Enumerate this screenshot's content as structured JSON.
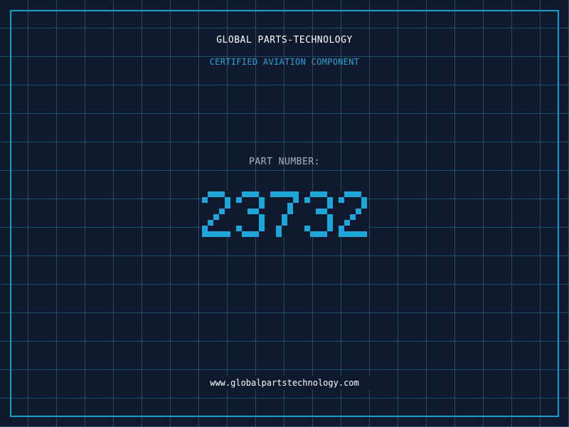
{
  "header": {
    "company": "GLOBAL PARTS-TECHNOLOGY",
    "tagline": "CERTIFIED AVIATION COMPONENT"
  },
  "part": {
    "label": "PART NUMBER:",
    "number": "23732"
  },
  "footer": {
    "url": "www.globalpartstechnology.com"
  },
  "colors": {
    "background": "#0f1a2e",
    "grid": "#227a96",
    "frame": "#1aa0c8",
    "accent": "#1ea6d6",
    "label": "#a9b6c8",
    "text": "#ffffff"
  }
}
